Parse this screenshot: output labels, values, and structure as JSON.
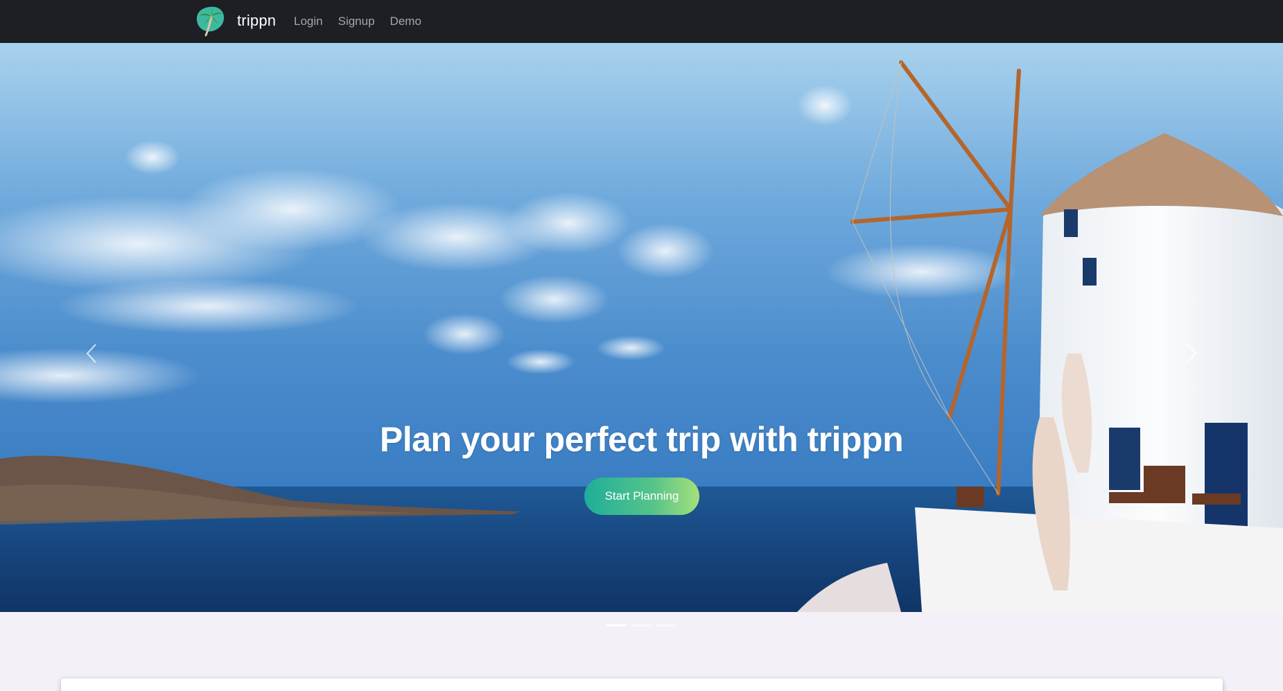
{
  "navbar": {
    "brand": {
      "name": "trippn",
      "logo_icon": "palm-tree-logo-icon"
    },
    "links": [
      {
        "label": "Login"
      },
      {
        "label": "Signup"
      },
      {
        "label": "Demo"
      }
    ],
    "background": "#1d1f24",
    "link_color": "#a3a6ab"
  },
  "hero": {
    "title": "Plan your perfect trip with trippn",
    "cta_label": "Start Planning",
    "cta_gradient": [
      "#1eae9a",
      "#a6e07a"
    ],
    "prev_icon": "chevron-left-icon",
    "next_icon": "chevron-right-icon",
    "slides_count": 3,
    "active_slide": 1
  },
  "colors": {
    "page_background": "#f3f0f8"
  }
}
